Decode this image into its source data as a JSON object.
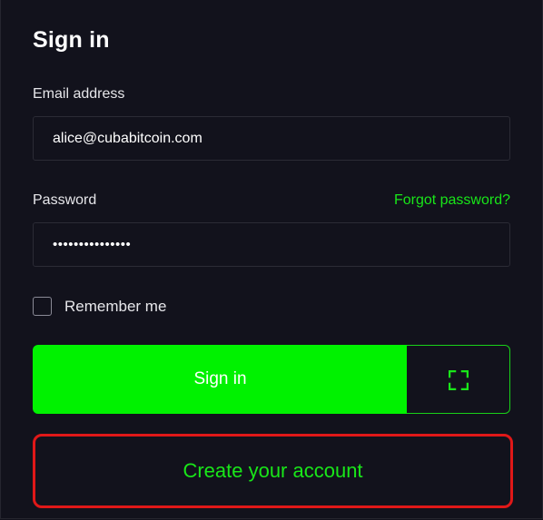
{
  "form": {
    "title": "Sign in",
    "email_label": "Email address",
    "email_value": "alice@cubabitcoin.com",
    "password_label": "Password",
    "forgot_password": "Forgot password?",
    "password_value": "•••••••••••••••",
    "remember_label": "Remember me",
    "remember_checked": false,
    "signin_button": "Sign in",
    "scan_icon": "qr-scan-icon",
    "create_account_button": "Create your account"
  },
  "colors": {
    "background": "#12121c",
    "accent_green": "#00f200",
    "link_green": "#19e619",
    "highlight_red": "#e01818"
  }
}
